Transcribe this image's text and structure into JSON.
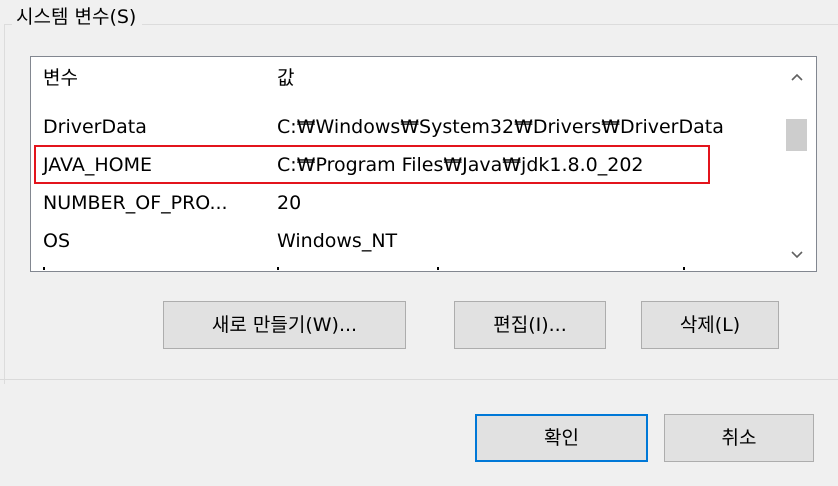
{
  "group": {
    "title": "시스템 변수(S)"
  },
  "table": {
    "columns": [
      "변수",
      "값"
    ],
    "rows": [
      {
        "name": "DriverData",
        "value": "C:₩Windows₩System32₩Drivers₩DriverData"
      },
      {
        "name": "JAVA_HOME",
        "value": "C:₩Program Files₩Java₩jdk1.8.0_202"
      },
      {
        "name": "NUMBER_OF_PRO...",
        "value": "20"
      },
      {
        "name": "OS",
        "value": "Windows_NT"
      }
    ]
  },
  "scrollbar": {
    "up_icon": "chevron-up-icon",
    "down_icon": "chevron-down-icon"
  },
  "buttons": {
    "new_label": "새로 만들기(W)...",
    "edit_label": "편집(I)...",
    "delete_label": "삭제(L)",
    "ok_label": "확인",
    "cancel_label": "취소"
  },
  "colors": {
    "highlight_border": "#e3141c",
    "default_button_border": "#0078d7",
    "window_bg": "#f0f0f0"
  }
}
